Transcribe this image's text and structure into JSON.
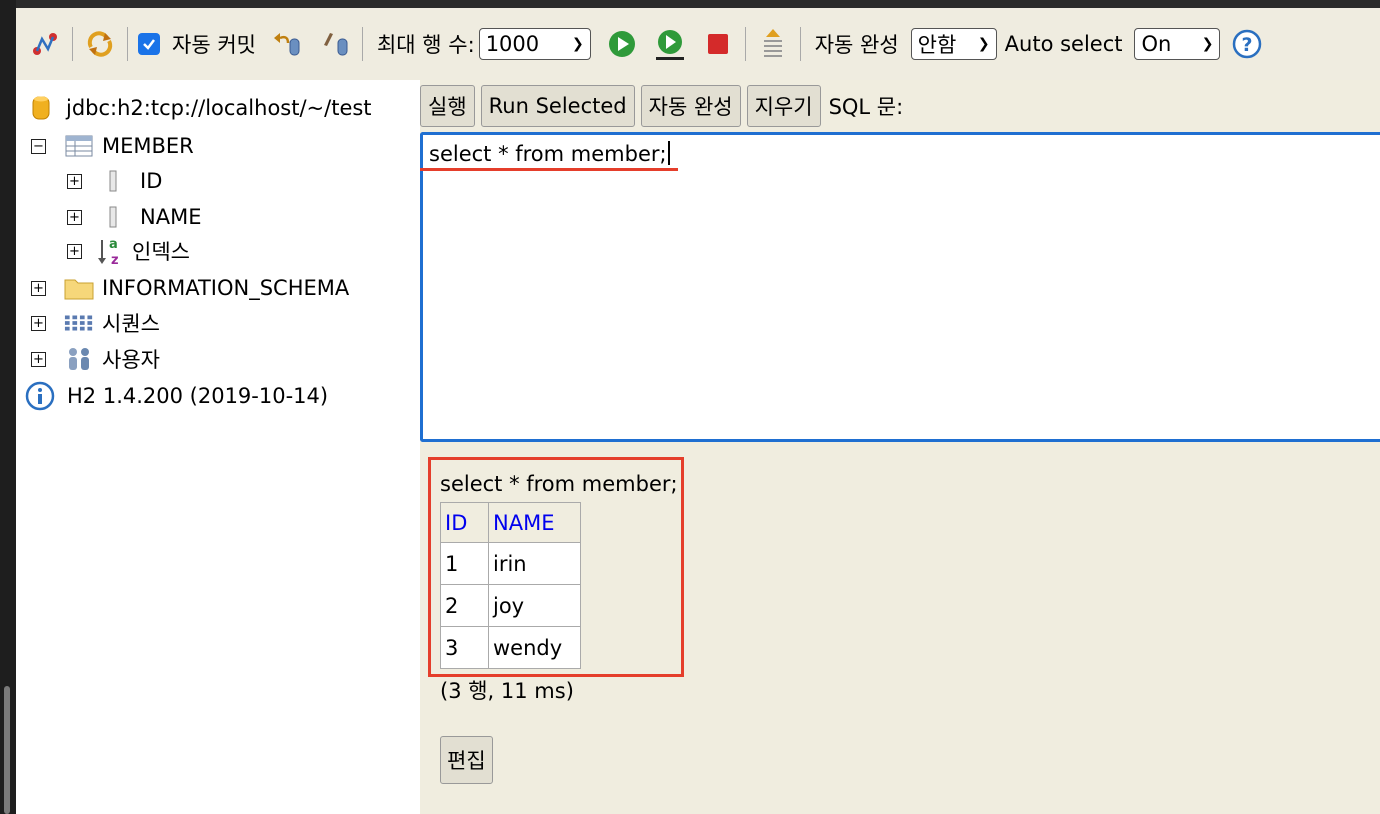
{
  "toolbar": {
    "autocommit_label": "자동 커밋",
    "autocommit_checked": true,
    "max_rows_label": "최대 행 수:",
    "max_rows_value": "1000",
    "autocomplete_label": "자동 완성",
    "autocomplete_value": "안함",
    "auto_select_label": "Auto select",
    "auto_select_value": "On",
    "icons": [
      "disconnect-icon",
      "refresh-icon",
      "rollback-icon",
      "commit-icon",
      "run-icon",
      "run-selected-icon",
      "stop-icon",
      "history-icon",
      "help-icon"
    ]
  },
  "tree": {
    "connection": "jdbc:h2:tcp://localhost/~/test",
    "table_name": "MEMBER",
    "columns": [
      "ID",
      "NAME"
    ],
    "indexes_label": "인덱스",
    "schema": "INFORMATION_SCHEMA",
    "sequences_label": "시퀀스",
    "users_label": "사용자",
    "version": "H2 1.4.200 (2019-10-14)"
  },
  "editor": {
    "buttons": {
      "run": "실행",
      "run_selected": "Run Selected",
      "autocomplete": "자동 완성",
      "clear": "지우기"
    },
    "sql_label": "SQL 문:",
    "sql_text": "select * from member;"
  },
  "result": {
    "sql": "select * from member;",
    "headers": [
      "ID",
      "NAME"
    ],
    "rows": [
      [
        "1",
        "irin"
      ],
      [
        "2",
        "joy"
      ],
      [
        "3",
        "wendy"
      ]
    ],
    "status": "(3 행, 11 ms)",
    "edit_label": "편집"
  },
  "colors": {
    "panel_bg": "#f0eddf",
    "editor_border": "#1f6fd1",
    "highlight_red": "#e53e2b",
    "header_link": "#0000ee"
  }
}
